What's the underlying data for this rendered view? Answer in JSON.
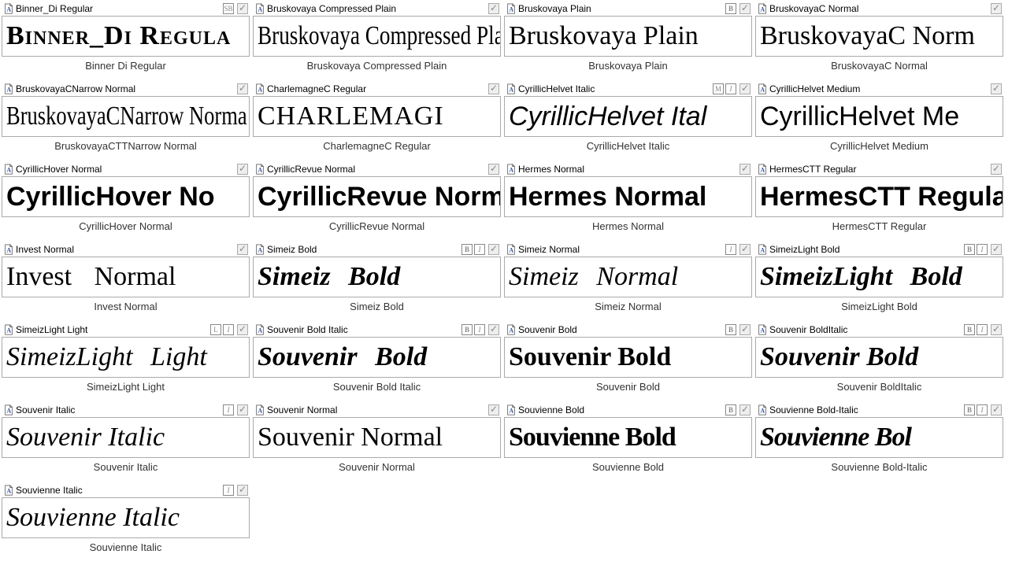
{
  "fonts": [
    {
      "name": "Binner_Di Regular",
      "preview": "Binner_Di Regula",
      "caption": "Binner Di Regular",
      "badges": [
        "SB"
      ],
      "cls": "f-binner"
    },
    {
      "name": "Bruskovaya Compressed Plain",
      "preview": "Bruskovaya Compressed Pla",
      "caption": "Bruskovaya Compressed Plain",
      "badges": [],
      "cls": "f-brusk-comp"
    },
    {
      "name": "Bruskovaya Plain",
      "preview": "Bruskovaya Plain",
      "caption": "Bruskovaya Plain",
      "badges": [
        "B"
      ],
      "cls": "f-brusk-plain"
    },
    {
      "name": "BruskovayaC Normal",
      "preview": "BruskovayaC Norm",
      "caption": "BruskovayaC Normal",
      "badges": [],
      "cls": "f-brusk-c"
    },
    {
      "name": "BruskovayaCNarrow Normal",
      "preview": "BruskovayaCNarrow Norma",
      "caption": "BruskovayaCTTNarrow Normal",
      "badges": [],
      "cls": "f-brusk-narrow"
    },
    {
      "name": "CharlemagneC Regular",
      "preview": "CHARLEMAGI",
      "caption": "CharlemagneC Regular",
      "badges": [],
      "cls": "f-charlemagne"
    },
    {
      "name": "CyrillicHelvet Italic",
      "preview": "CyrillicHelvet Ital",
      "caption": "CyrillicHelvet Italic",
      "badges": [
        "M",
        "I"
      ],
      "cls": "f-cyrhelv-it"
    },
    {
      "name": "CyrillicHelvet Medium",
      "preview": "CyrillicHelvet Me",
      "caption": "CyrillicHelvet Medium",
      "badges": [],
      "cls": "f-cyrhelv-med"
    },
    {
      "name": "CyrillicHover Normal",
      "preview": "CyrillicHover No",
      "caption": "CyrillicHover Normal",
      "badges": [],
      "cls": "f-cyrhover"
    },
    {
      "name": "CyrillicRevue Normal",
      "preview": "CyrillicRevue Norm",
      "caption": "CyrillicRevue Normal",
      "badges": [],
      "cls": "f-cyrrevue"
    },
    {
      "name": "Hermes Normal",
      "preview": "Hermes Normal",
      "caption": "Hermes Normal",
      "badges": [],
      "cls": "f-hermes"
    },
    {
      "name": "HermesCTT Regular",
      "preview": "HermesCTT Regular",
      "caption": "HermesCTT Regular",
      "badges": [],
      "cls": "f-hermesctt"
    },
    {
      "name": "Invest Normal",
      "preview": "Invest Normal",
      "caption": "Invest Normal",
      "badges": [],
      "cls": "f-invest"
    },
    {
      "name": "Simeiz Bold",
      "preview": "Simeiz Bold",
      "caption": "Simeiz Bold",
      "badges": [
        "B",
        "I"
      ],
      "cls": "f-simeiz-b"
    },
    {
      "name": "Simeiz Normal",
      "preview": "Simeiz Normal",
      "caption": "Simeiz Normal",
      "badges": [
        "I"
      ],
      "cls": "f-simeiz-n"
    },
    {
      "name": "SimeizLight Bold",
      "preview": "SimeizLight Bold",
      "caption": "SimeizLight Bold",
      "badges": [
        "B",
        "I"
      ],
      "cls": "f-simeizl-b"
    },
    {
      "name": "SimeizLight Light",
      "preview": "SimeizLight Light",
      "caption": "SimeizLight Light",
      "badges": [
        "L",
        "I"
      ],
      "cls": "f-simeizl-l"
    },
    {
      "name": "Souvenir Bold Italic",
      "preview": "Souvenir Bold",
      "caption": "Souvenir Bold Italic",
      "badges": [
        "B",
        "I"
      ],
      "cls": "f-souv-bi"
    },
    {
      "name": "Souvenir Bold",
      "preview": "Souvenir Bold",
      "caption": "Souvenir Bold",
      "badges": [
        "B"
      ],
      "cls": "f-souv-b"
    },
    {
      "name": "Souvenir BoldItalic",
      "preview": "Souvenir Bold",
      "caption": "Souvenir BoldItalic",
      "badges": [
        "B",
        "I"
      ],
      "cls": "f-souv-bi2"
    },
    {
      "name": "Souvenir Italic",
      "preview": "Souvenir Italic",
      "caption": "Souvenir Italic",
      "badges": [
        "I"
      ],
      "cls": "f-souv-i"
    },
    {
      "name": "Souvenir Normal",
      "preview": "Souvenir Normal",
      "caption": "Souvenir Normal",
      "badges": [],
      "cls": "f-souv-n"
    },
    {
      "name": "Souvienne Bold",
      "preview": "Souvienne Bold",
      "caption": "Souvienne Bold",
      "badges": [
        "B"
      ],
      "cls": "f-souvie-b"
    },
    {
      "name": "Souvienne Bold-Italic",
      "preview": "Souvienne Bol",
      "caption": "Souvienne Bold-Italic",
      "badges": [
        "B",
        "I"
      ],
      "cls": "f-souvie-bi"
    },
    {
      "name": "Souvienne Italic",
      "preview": "Souvienne Italic",
      "caption": "Souvienne Italic",
      "badges": [
        "I"
      ],
      "cls": "f-souvie-i"
    }
  ]
}
